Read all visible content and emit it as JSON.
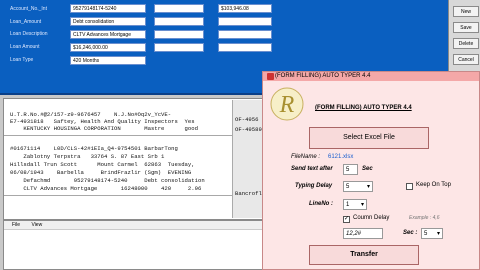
{
  "form": {
    "labels": [
      "Account_No._Int",
      "Loan_Amount",
      "Loan Description",
      "Loan Amount",
      "Loan Type"
    ],
    "fields": [
      "95279148174-5240",
      "$16,246,000.00",
      "CLTV Advances Mortgage",
      "Debt consolidation",
      "420 Months"
    ],
    "right_labels": [
      "",
      "",
      "",
      ""
    ],
    "right_fields": [
      "$103,946.08",
      "",
      "",
      ""
    ]
  },
  "side_buttons": [
    "New",
    "Save",
    "Delete",
    "Cancel"
  ],
  "doc_lines": [
    "U.T.R.No.#@2/157-z9-9676457    N.J.No#Oq2v_YcVE-",
    "E7-4931818   Saftey, Health And Quality Inspectors  Yes",
    "    KENTUCKY HOUSINGA CORPORATION       Mastre      good",
    "#01671114    L0D/CLS-42#1EIa_Q4-9754501 BarbarTong",
    "    Zablotny Terpstra   33764 S. 87 East Srb 1",
    "Hillsdall Trun Scott      Mount Carmel  62863  Tuesday,",
    "06/08/1943    Barbella     BrindFrazlir (Sgm)  EVENING",
    "    Defachmd       95279148174-5240     Debt consolidation",
    "    CLTV Advances Mortgage       16248000    420     2.96"
  ],
  "doc_side": [
    "OF-4956",
    "OF-49589",
    "Bancrofl"
  ],
  "editor_menu": [
    "File",
    "View"
  ],
  "dialog": {
    "title": "(FORM FILLING) AUTO TYPER 4.4",
    "heading": "(FORM FILLING) AUTO TYPER 4.4",
    "select_btn": "Select Excel File",
    "filename_label": "FileName :",
    "filename_value": "6121.xlsx",
    "send_text_label": "Send text after",
    "send_text_value": "5",
    "sec_label": "Sec",
    "typing_delay_label": "Typing Delay",
    "typing_delay_value": "5",
    "keep_on_top": "Keep On Top",
    "lineno_label": "LineNo :",
    "lineno_value": "1",
    "column_delay": "Coumn Delay",
    "example": "Example : 4,6",
    "col_value": "12,2#",
    "sec2_label": "Sec :",
    "sec2_value": "5",
    "transfer_btn": "Transfer"
  }
}
